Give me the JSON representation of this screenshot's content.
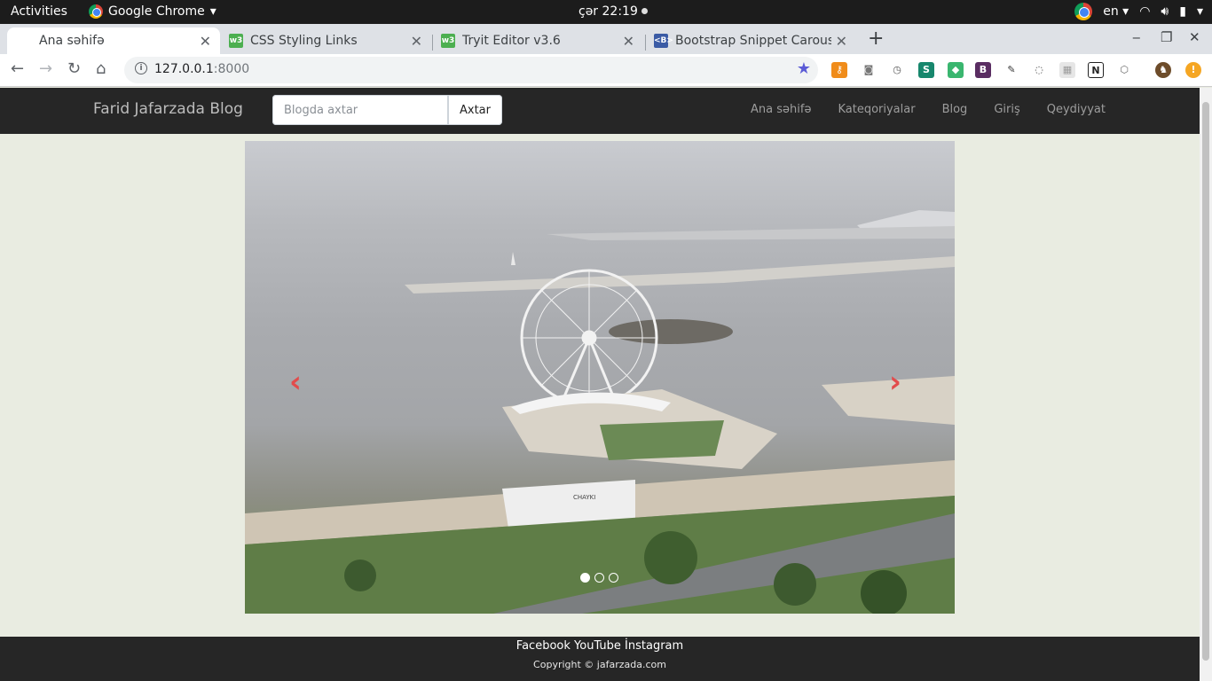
{
  "system_bar": {
    "activities": "Activities",
    "app_name": "Google Chrome",
    "clock": "çər 22:19",
    "language": "en"
  },
  "tabs": [
    {
      "title": "Ana səhifə",
      "icon": "page-icon",
      "active": true
    },
    {
      "title": "CSS Styling Links",
      "icon": "w3schools-icon",
      "active": false
    },
    {
      "title": "Tryit Editor v3.6",
      "icon": "w3schools-icon",
      "active": false
    },
    {
      "title": "Bootstrap Snippet Carous",
      "icon": "bootsnipp-icon",
      "active": false
    }
  ],
  "toolbar": {
    "url_host": "127.0.0.1",
    "url_port": ":8000"
  },
  "site": {
    "brand": "Farid Jafarzada Blog",
    "search_placeholder": "Blogda axtar",
    "search_button": "Axtar",
    "nav": [
      "Ana səhifə",
      "Kateqoriyalar",
      "Blog",
      "Giriş",
      "Qeydiyyat"
    ]
  },
  "carousel": {
    "slide_count": 3,
    "active_index": 0,
    "building_sign": "CHAYKI"
  },
  "footer": {
    "links": [
      "Facebook",
      "YouTube",
      "İnstagram"
    ],
    "copyright": "Copyright © jafarzada.com"
  },
  "colors": {
    "navbar_bg": "#262626",
    "page_bg": "#e9ece1",
    "carousel_arrow": "#e24c4c"
  }
}
